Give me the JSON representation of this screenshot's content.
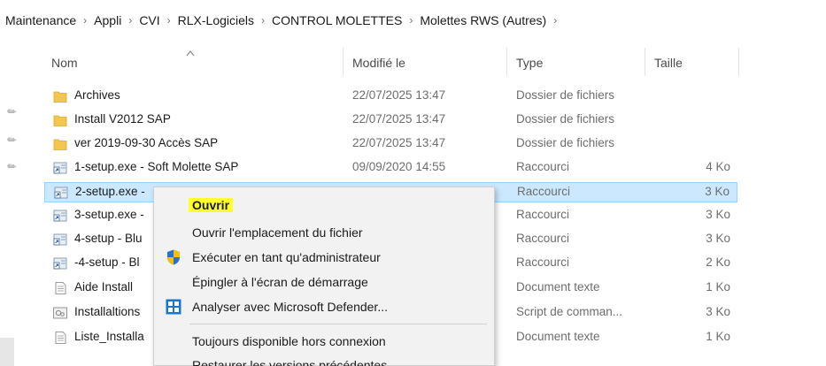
{
  "breadcrumb": [
    "Maintenance",
    "Appli",
    "CVI",
    "RLX-Logiciels",
    "CONTROL MOLETTES",
    "Molettes RWS (Autres)"
  ],
  "columns": {
    "name": "Nom",
    "modified": "Modifié le",
    "type": "Type",
    "size": "Taille"
  },
  "rows": [
    {
      "name": "Archives",
      "modified": "22/07/2025 13:47",
      "type": "Dossier de fichiers",
      "size": "",
      "icon": "folder-icon"
    },
    {
      "name": "Install V2012 SAP",
      "modified": "22/07/2025 13:47",
      "type": "Dossier de fichiers",
      "size": "",
      "icon": "folder-icon"
    },
    {
      "name": "ver 2019-09-30 Accès SAP",
      "modified": "22/07/2025 13:47",
      "type": "Dossier de fichiers",
      "size": "",
      "icon": "folder-icon"
    },
    {
      "name": "1-setup.exe - Soft Molette SAP",
      "modified": "09/09/2020 14:55",
      "type": "Raccourci",
      "size": "4 Ko",
      "icon": "shortcut-icon"
    },
    {
      "name": "2-setup.exe -",
      "modified": "",
      "type": "Raccourci",
      "size": "3 Ko",
      "icon": "shortcut-icon",
      "selected": true
    },
    {
      "name": "3-setup.exe -",
      "modified": "",
      "type": "Raccourci",
      "size": "3 Ko",
      "icon": "shortcut-icon"
    },
    {
      "name": "4-setup - Blu",
      "modified": "",
      "type": "Raccourci",
      "size": "3 Ko",
      "icon": "shortcut-icon"
    },
    {
      "name": "-4-setup - Bl",
      "modified": "",
      "type": "Raccourci",
      "size": "2 Ko",
      "icon": "shortcut-icon"
    },
    {
      "name": "Aide Install",
      "modified": "",
      "type": "Document texte",
      "size": "1 Ko",
      "icon": "text-document-icon"
    },
    {
      "name": "Installaltions",
      "modified": "",
      "type": "Script de comman...",
      "size": "3 Ko",
      "icon": "script-icon"
    },
    {
      "name": "Liste_Installa",
      "modified": "",
      "type": "Document texte",
      "size": "1 Ko",
      "icon": "text-document-icon"
    }
  ],
  "context_menu": {
    "open": "Ouvrir",
    "open_location": "Ouvrir l'emplacement du fichier",
    "run_as_admin": "Exécuter en tant qu'administrateur",
    "pin_start": "Épingler à l'écran de démarrage",
    "defender_scan": "Analyser avec Microsoft Defender...",
    "always_offline": "Toujours disponible hors connexion",
    "restore_versions": "Restaurer les versions précédentes"
  },
  "colors": {
    "selection": "#cce8ff",
    "highlight": "#ffff2e",
    "folder": "#f3c74f"
  }
}
